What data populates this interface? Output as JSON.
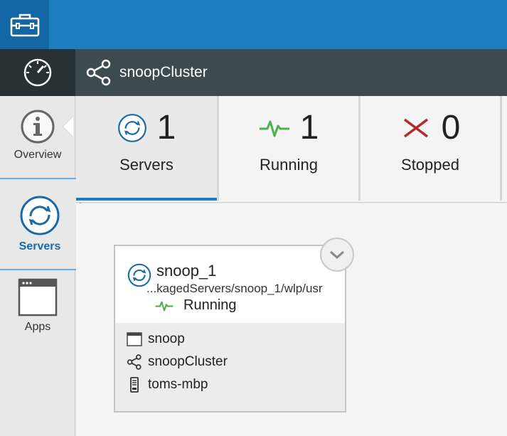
{
  "colors": {
    "topbar": "#1d7ebf",
    "accent": "#1b6aa8",
    "running": "#4caf50",
    "stopped": "#b02a2a"
  },
  "header": {
    "cluster_title": "snoopCluster",
    "toolbox_icon": "toolbox-icon",
    "dashboard_icon": "dashboard-gauge-icon",
    "cluster_icon": "cluster-share-icon"
  },
  "sidebar": {
    "items": [
      {
        "label": "Overview",
        "icon": "info-icon"
      },
      {
        "label": "Servers",
        "icon": "server-sync-icon",
        "selected": true
      },
      {
        "label": "Apps",
        "icon": "app-window-icon"
      }
    ]
  },
  "stats": [
    {
      "count": "1",
      "label": "Servers",
      "icon": "server-sync-icon",
      "selected": true
    },
    {
      "count": "1",
      "label": "Running",
      "icon": "pulse-icon"
    },
    {
      "count": "0",
      "label": "Stopped",
      "icon": "x-icon"
    }
  ],
  "server_card": {
    "name": "snoop_1",
    "path": "...kagedServers/snoop_1/wlp/usr",
    "status": "Running",
    "app": "snoop",
    "cluster": "snoopCluster",
    "host": "toms-mbp"
  }
}
